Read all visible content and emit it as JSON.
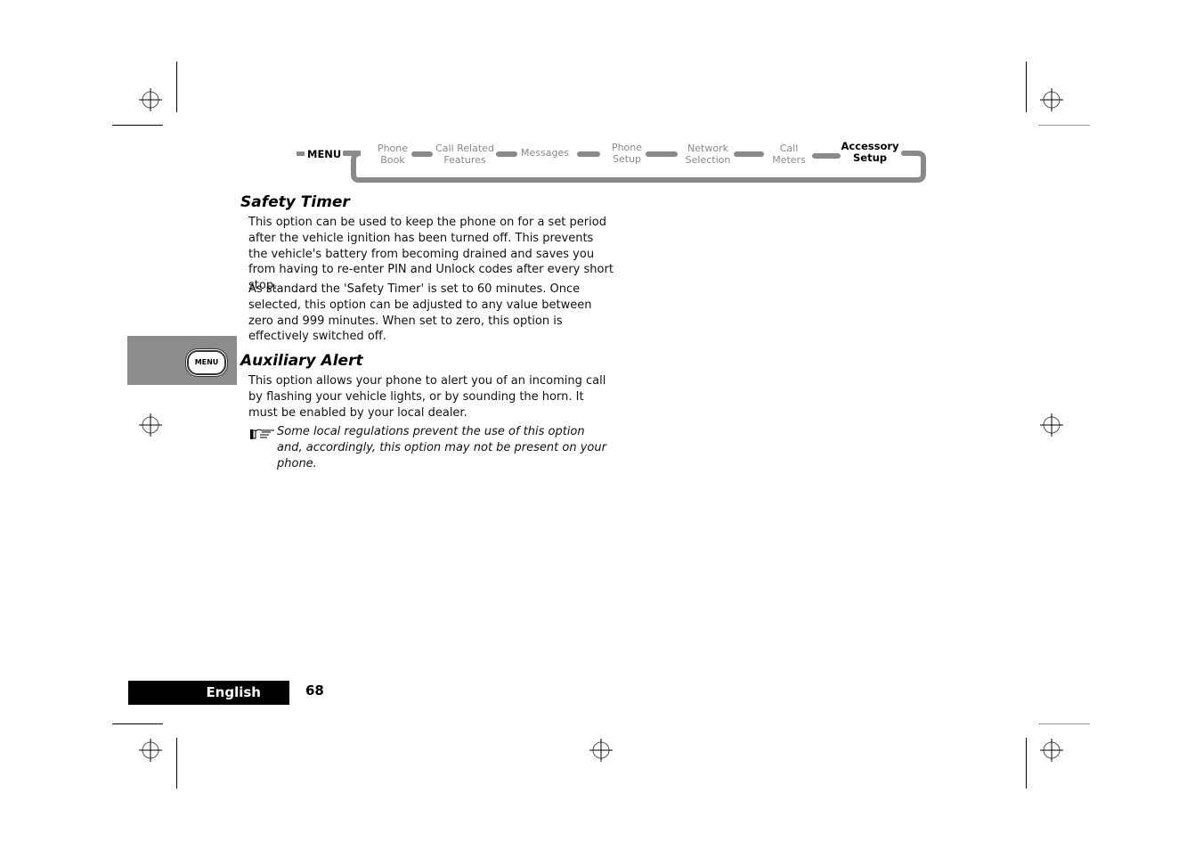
{
  "nav": {
    "menu_label": "MENU",
    "items": [
      {
        "line1": "Phone",
        "line2": "Book",
        "active": false
      },
      {
        "line1": "Call Related",
        "line2": "Features",
        "active": false
      },
      {
        "line1": "Messages",
        "line2": "",
        "active": false
      },
      {
        "line1": "Phone",
        "line2": "Setup",
        "active": false
      },
      {
        "line1": "Network",
        "line2": "Selection",
        "active": false
      },
      {
        "line1": "Call",
        "line2": "Meters",
        "active": false
      },
      {
        "line1": "Accessory",
        "line2": "Setup",
        "active": true
      }
    ]
  },
  "side_tab": {
    "button_label": "MENU"
  },
  "sections": [
    {
      "title": "Safety Timer",
      "paragraphs": [
        "This option can be used to keep the phone on for a set period after the vehicle ignition has been turned off. This prevents the vehicle's battery from becoming drained and saves you from having to re-enter PIN and Unlock codes after every short stop.",
        "As standard the 'Safety Timer' is set to 60 minutes. Once selected, this option can be adjusted to any value between zero and 999 minutes. When set to zero, this option is effectively switched off."
      ]
    },
    {
      "title": "Auxiliary Alert",
      "paragraphs": [
        "This option allows your phone to alert you of an incoming call by flashing your vehicle lights, or by sounding the horn. It must be enabled by your local dealer."
      ],
      "note": "Some local regulations prevent the use of this option and, accordingly, this option may not be present on your phone."
    }
  ],
  "footer": {
    "language": "English",
    "page_number": "68"
  }
}
